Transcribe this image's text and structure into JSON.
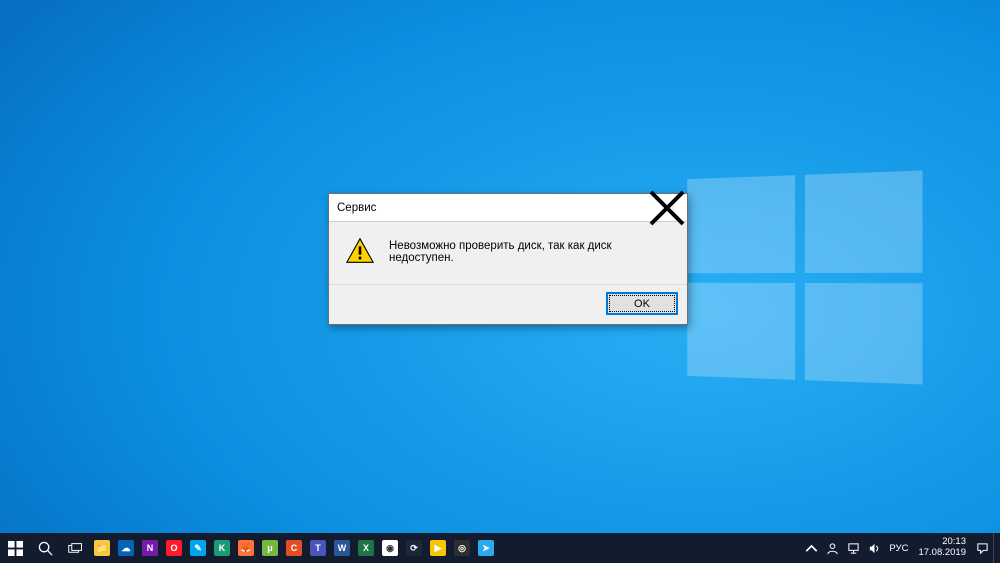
{
  "dialog": {
    "title": "Сервис",
    "message": "Невозможно проверить диск, так как диск недоступен.",
    "ok_label": "OK"
  },
  "taskbar": {
    "apps": [
      {
        "name": "file-explorer",
        "bg": "#f5c842",
        "glyph": "📁"
      },
      {
        "name": "onedrive",
        "bg": "#0364b8",
        "glyph": "☁"
      },
      {
        "name": "onenote",
        "bg": "#7719aa",
        "glyph": "N"
      },
      {
        "name": "opera",
        "bg": "#ff1b2d",
        "glyph": "O"
      },
      {
        "name": "paint3d",
        "bg": "#00a4ef",
        "glyph": "✎"
      },
      {
        "name": "kaspersky",
        "bg": "#1c9b77",
        "glyph": "K"
      },
      {
        "name": "firefox",
        "bg": "#ff7139",
        "glyph": "🦊"
      },
      {
        "name": "utorrent",
        "bg": "#76b83f",
        "glyph": "μ"
      },
      {
        "name": "ccleaner",
        "bg": "#e44d26",
        "glyph": "C"
      },
      {
        "name": "teams",
        "bg": "#4b53bc",
        "glyph": "T"
      },
      {
        "name": "word",
        "bg": "#2b579a",
        "glyph": "W"
      },
      {
        "name": "excel",
        "bg": "#217346",
        "glyph": "X"
      },
      {
        "name": "chrome",
        "bg": "#ffffff",
        "glyph": "◉"
      },
      {
        "name": "steam",
        "bg": "#1b2838",
        "glyph": "⟳"
      },
      {
        "name": "potplayer",
        "bg": "#f7c600",
        "glyph": "▶"
      },
      {
        "name": "obs",
        "bg": "#2e2e2e",
        "glyph": "◎"
      },
      {
        "name": "telegram",
        "bg": "#2aabee",
        "glyph": "➤"
      }
    ]
  },
  "tray": {
    "language": "РУС",
    "time": "20:13",
    "date": "17.08.2019"
  }
}
